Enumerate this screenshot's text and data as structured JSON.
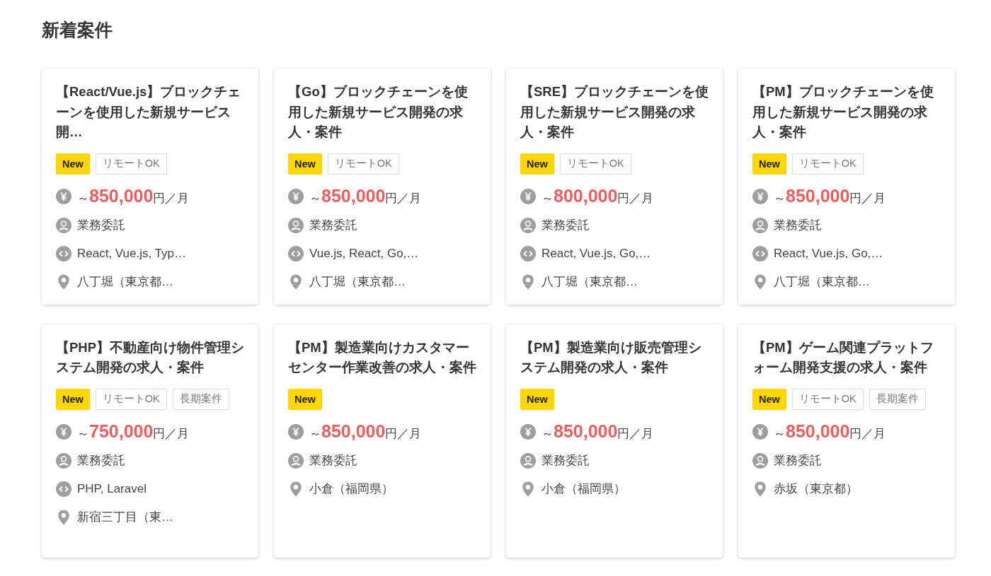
{
  "heading": "新着案件",
  "jobs": [
    {
      "title": "【React/Vue.js】ブロックチェーンを使用した新規サービス開…",
      "tags": [
        {
          "label": "New",
          "kind": "new"
        },
        {
          "label": "リモートOK",
          "kind": "plain"
        }
      ],
      "salary": {
        "prefix": "～",
        "amount": "850,000",
        "unit": "円／月"
      },
      "details": [
        {
          "kind": "contract",
          "text": "業務委託"
        },
        {
          "kind": "skills",
          "text": "React, Vue.js, Typ…"
        },
        {
          "kind": "location",
          "text": "八丁堀（東京都…"
        }
      ]
    },
    {
      "title": "【Go】ブロックチェーンを使用した新規サービス開発の求人・案件",
      "tags": [
        {
          "label": "New",
          "kind": "new"
        },
        {
          "label": "リモートOK",
          "kind": "plain"
        }
      ],
      "salary": {
        "prefix": "～",
        "amount": "850,000",
        "unit": "円／月"
      },
      "details": [
        {
          "kind": "contract",
          "text": "業務委託"
        },
        {
          "kind": "skills",
          "text": "Vue.js, React, Go,…"
        },
        {
          "kind": "location",
          "text": "八丁堀（東京都…"
        }
      ]
    },
    {
      "title": "【SRE】ブロックチェーンを使用した新規サービス開発の求人・案件",
      "tags": [
        {
          "label": "New",
          "kind": "new"
        },
        {
          "label": "リモートOK",
          "kind": "plain"
        }
      ],
      "salary": {
        "prefix": "～",
        "amount": "800,000",
        "unit": "円／月"
      },
      "details": [
        {
          "kind": "contract",
          "text": "業務委託"
        },
        {
          "kind": "skills",
          "text": "React, Vue.js, Go,…"
        },
        {
          "kind": "location",
          "text": "八丁堀（東京都…"
        }
      ]
    },
    {
      "title": "【PM】ブロックチェーンを使用した新規サービス開発の求人・案件",
      "tags": [
        {
          "label": "New",
          "kind": "new"
        },
        {
          "label": "リモートOK",
          "kind": "plain"
        }
      ],
      "salary": {
        "prefix": "～",
        "amount": "850,000",
        "unit": "円／月"
      },
      "details": [
        {
          "kind": "contract",
          "text": "業務委託"
        },
        {
          "kind": "skills",
          "text": "React, Vue.js, Go,…"
        },
        {
          "kind": "location",
          "text": "八丁堀（東京都…"
        }
      ]
    },
    {
      "title": "【PHP】不動産向け物件管理システム開発の求人・案件",
      "tags": [
        {
          "label": "New",
          "kind": "new"
        },
        {
          "label": "リモートOK",
          "kind": "plain"
        },
        {
          "label": "長期案件",
          "kind": "plain"
        }
      ],
      "salary": {
        "prefix": "～",
        "amount": "750,000",
        "unit": "円／月"
      },
      "details": [
        {
          "kind": "contract",
          "text": "業務委託"
        },
        {
          "kind": "skills",
          "text": "PHP, Laravel"
        },
        {
          "kind": "location",
          "text": "新宿三丁目（東…"
        }
      ]
    },
    {
      "title": "【PM】製造業向けカスタマーセンター作業改善の求人・案件",
      "tags": [
        {
          "label": "New",
          "kind": "new"
        }
      ],
      "salary": {
        "prefix": "～",
        "amount": "850,000",
        "unit": "円／月"
      },
      "details": [
        {
          "kind": "contract",
          "text": "業務委託"
        },
        {
          "kind": "location",
          "text": "小倉（福岡県）"
        }
      ]
    },
    {
      "title": "【PM】製造業向け販売管理システム開発の求人・案件",
      "tags": [
        {
          "label": "New",
          "kind": "new"
        }
      ],
      "salary": {
        "prefix": "～",
        "amount": "850,000",
        "unit": "円／月"
      },
      "details": [
        {
          "kind": "contract",
          "text": "業務委託"
        },
        {
          "kind": "location",
          "text": "小倉（福岡県）"
        }
      ]
    },
    {
      "title": "【PM】ゲーム関連プラットフォーム開発支援の求人・案件",
      "tags": [
        {
          "label": "New",
          "kind": "new"
        },
        {
          "label": "リモートOK",
          "kind": "plain"
        },
        {
          "label": "長期案件",
          "kind": "plain"
        }
      ],
      "salary": {
        "prefix": "～",
        "amount": "850,000",
        "unit": "円／月"
      },
      "details": [
        {
          "kind": "contract",
          "text": "業務委託"
        },
        {
          "kind": "location",
          "text": "赤坂（東京都）"
        }
      ]
    }
  ]
}
